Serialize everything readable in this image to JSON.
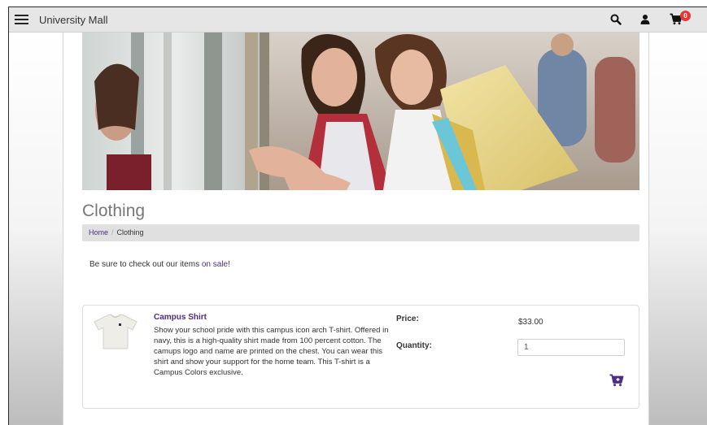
{
  "navbar": {
    "brand": "University Mall",
    "cart_count": "0"
  },
  "page": {
    "title": "Clothing"
  },
  "breadcrumb": {
    "home": "Home",
    "current": "Clothing"
  },
  "intro": {
    "text": "Be sure to check out our items ",
    "link": "on sale!"
  },
  "product": {
    "name": "Campus Shirt",
    "description": "Show your school pride with this campus icon arch T-shirt. Offered in navy, this is a high-quality shirt made from 100 percent cotton. The camups logo and name are printed on the chest. You can wear this shirt and show your support for the home team. This T-shirt is a Campus Colors exclusive.",
    "price_label": "Price:",
    "price": "$33.00",
    "quantity_label": "Quantity:",
    "quantity": "1"
  },
  "colors": {
    "accent": "#4b2e83",
    "badge": "#e53935"
  },
  "icons": [
    "hamburger-menu-icon",
    "search-icon",
    "user-icon",
    "cart-icon",
    "add-to-cart-icon"
  ]
}
